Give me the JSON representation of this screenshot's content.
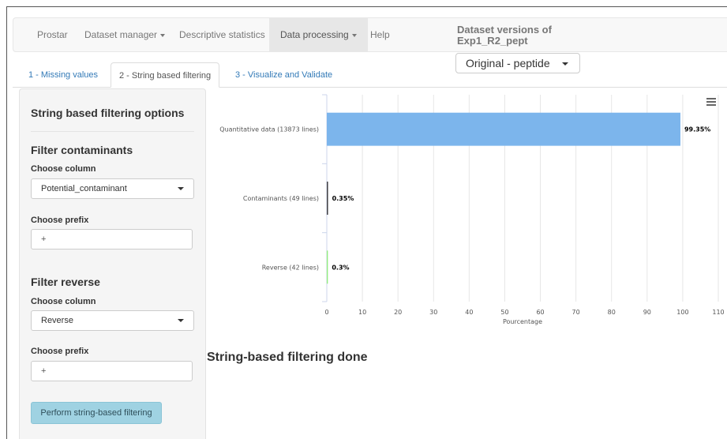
{
  "navbar": {
    "brand": "Prostar",
    "items": [
      {
        "label": "Dataset manager",
        "dropdown": true
      },
      {
        "label": "Descriptive statistics",
        "dropdown": false
      },
      {
        "label": "Data processing",
        "dropdown": true,
        "active": true
      },
      {
        "label": "Help",
        "dropdown": false
      }
    ],
    "dataset_title_line1": "Dataset versions of",
    "dataset_title_line2": "Exp1_R2_pept"
  },
  "version_select": {
    "value": "Original - peptide"
  },
  "tabs": [
    {
      "label": "1 - Missing values"
    },
    {
      "label": "2 - String based filtering",
      "active": true
    },
    {
      "label": "3 - Visualize and Validate"
    }
  ],
  "sidebar": {
    "title": "String based filtering options",
    "contaminants": {
      "heading": "Filter contaminants",
      "column_label": "Choose column",
      "column_value": "Potential_contaminant",
      "prefix_label": "Choose prefix",
      "prefix_value": "+"
    },
    "reverse": {
      "heading": "Filter reverse",
      "column_label": "Choose column",
      "column_value": "Reverse",
      "prefix_label": "Choose prefix",
      "prefix_value": "+"
    },
    "perform_button": "Perform string-based filtering"
  },
  "status_message": "String-based filtering done",
  "chart_data": {
    "type": "bar",
    "orientation": "horizontal",
    "categories": [
      "Quantitative data (13873 lines)",
      "Contaminants (49 lines)",
      "Reverse (42 lines)"
    ],
    "values": [
      99.35,
      0.35,
      0.3
    ],
    "data_labels": [
      "99.35%",
      "0.35%",
      "0.3%"
    ],
    "colors": [
      "#7cb5ec",
      "#434348",
      "#90ed7d"
    ],
    "xlabel": "Pourcentage",
    "xlim": [
      0,
      110
    ],
    "xticks": [
      0,
      10,
      20,
      30,
      40,
      50,
      60,
      70,
      80,
      90,
      100,
      110
    ],
    "grid": true,
    "legend": "none"
  },
  "colors": {
    "navbar_bg": "#f8f8f8",
    "link": "#337ab7",
    "button_bg": "#9fd2e2"
  }
}
